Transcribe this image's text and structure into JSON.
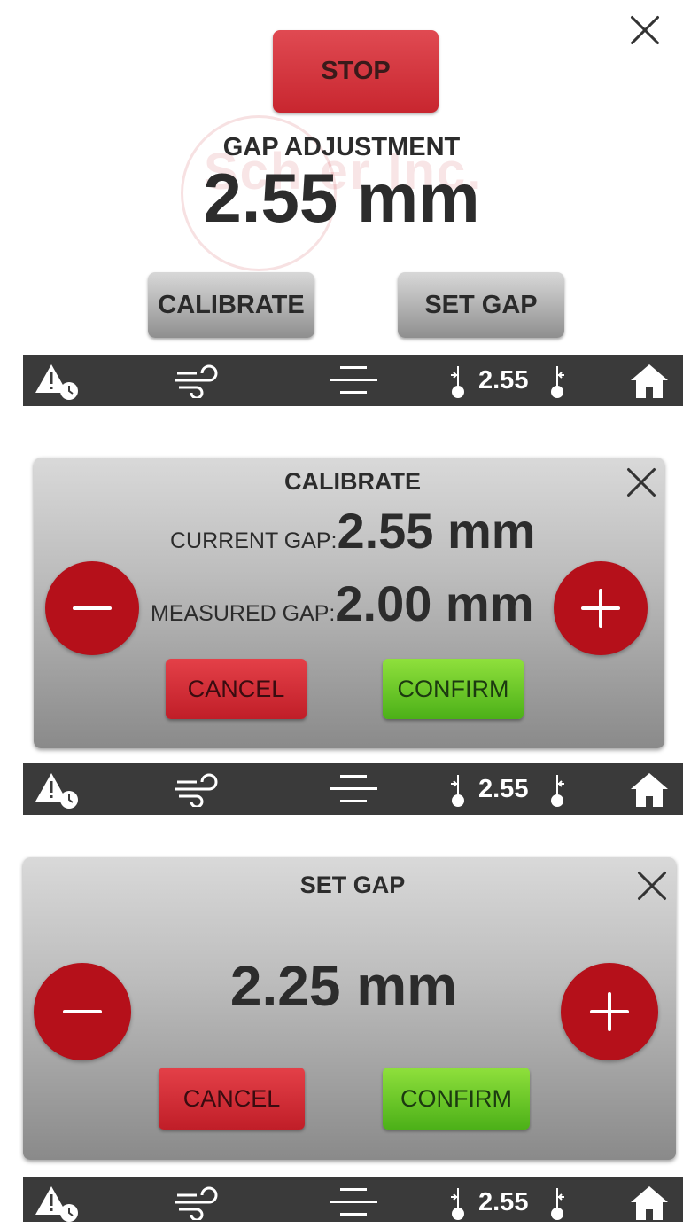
{
  "panel1": {
    "stop_label": "STOP",
    "title": "GAP ADJUSTMENT",
    "gap_value": "2.55 mm",
    "calibrate_label": "CALIBRATE",
    "set_gap_label": "SET GAP",
    "watermark_text": "Sch  er Inc."
  },
  "statusbar": {
    "gap_value": "2.55",
    "icons": [
      "alert-clock-icon",
      "wind-icon",
      "menu-icon",
      "gap-left-icon",
      "gap-right-icon",
      "home-icon"
    ],
    "background": "#3a3a3a"
  },
  "calibrate_dialog": {
    "title": "CALIBRATE",
    "current_label": "CURRENT GAP:",
    "current_value": "2.55 mm",
    "measured_label": "MEASURED GAP:",
    "measured_value": "2.00 mm",
    "cancel_label": "CANCEL",
    "confirm_label": "CONFIRM"
  },
  "setgap_dialog": {
    "title": "SET GAP",
    "value": "2.25 mm",
    "cancel_label": "CANCEL",
    "confirm_label": "CONFIRM"
  },
  "colors": {
    "red_accent": "#b5101a",
    "green_confirm": "#6cc82a",
    "red_cancel": "#d3323a"
  }
}
